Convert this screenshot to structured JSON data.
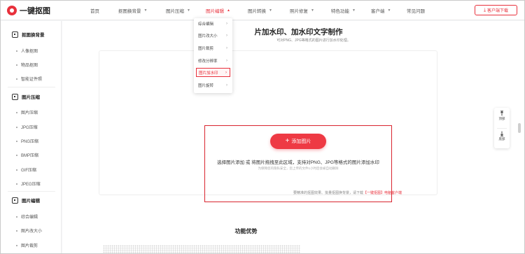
{
  "brand": {
    "name": "一键抠图",
    "accent": "#e8313c"
  },
  "nav": {
    "items": [
      {
        "label": "首页",
        "has_caret": false
      },
      {
        "label": "抠图换背景",
        "has_caret": true
      },
      {
        "label": "图片压缩",
        "has_caret": true
      },
      {
        "label": "图片编辑",
        "has_caret": true,
        "active": true
      },
      {
        "label": "图片转换",
        "has_caret": true
      },
      {
        "label": "照片修复",
        "has_caret": true
      },
      {
        "label": "特色功能",
        "has_caret": true
      },
      {
        "label": "客户端",
        "has_caret": true
      },
      {
        "label": "常见问题",
        "has_caret": false
      }
    ],
    "download_label": "客户端下载",
    "download_icon": "download-icon"
  },
  "sidebar": {
    "sections": [
      {
        "title": "抠图换背景",
        "icon": "image-icon",
        "items": [
          "人像抠图",
          "物品抠图",
          "智能证件照"
        ]
      },
      {
        "title": "图片压缩",
        "icon": "image-icon",
        "items": [
          "图片压缩",
          "JPG压缩",
          "PNG压缩",
          "BMP压缩",
          "GIF压缩",
          "JPEG压缩"
        ]
      },
      {
        "title": "图片编辑",
        "icon": "image-icon",
        "items": [
          "综合编辑",
          "图片改大小",
          "图片裁剪"
        ]
      }
    ]
  },
  "dropdown": {
    "items": [
      "综合编辑",
      "图片改大小",
      "图片裁剪",
      "修改分辨率",
      "图片加水印",
      "图片旋转"
    ],
    "selected": 4
  },
  "main": {
    "title": "片加水印、加水印文字制作",
    "subtitle": "可对PNG、JPG等格式的图片进行加水印处理。",
    "add_button": "添加图片",
    "drop_hint": "选择图片添加 或 将图片拖拽至此区域，支持对PNG、JPG等格式的图片添加水印",
    "privacy": "为保障您的隐私安全，您上传的文件1小时后会被自动删除",
    "footnote_prefix": "要精准的抠图效果、批量抠图换背景，请下载",
    "footnote_link": "【一键抠图】电脑客户端",
    "advantages_title": "功能优势"
  },
  "float_tools": {
    "top_label": "顶部",
    "bottom_label": "底部"
  }
}
